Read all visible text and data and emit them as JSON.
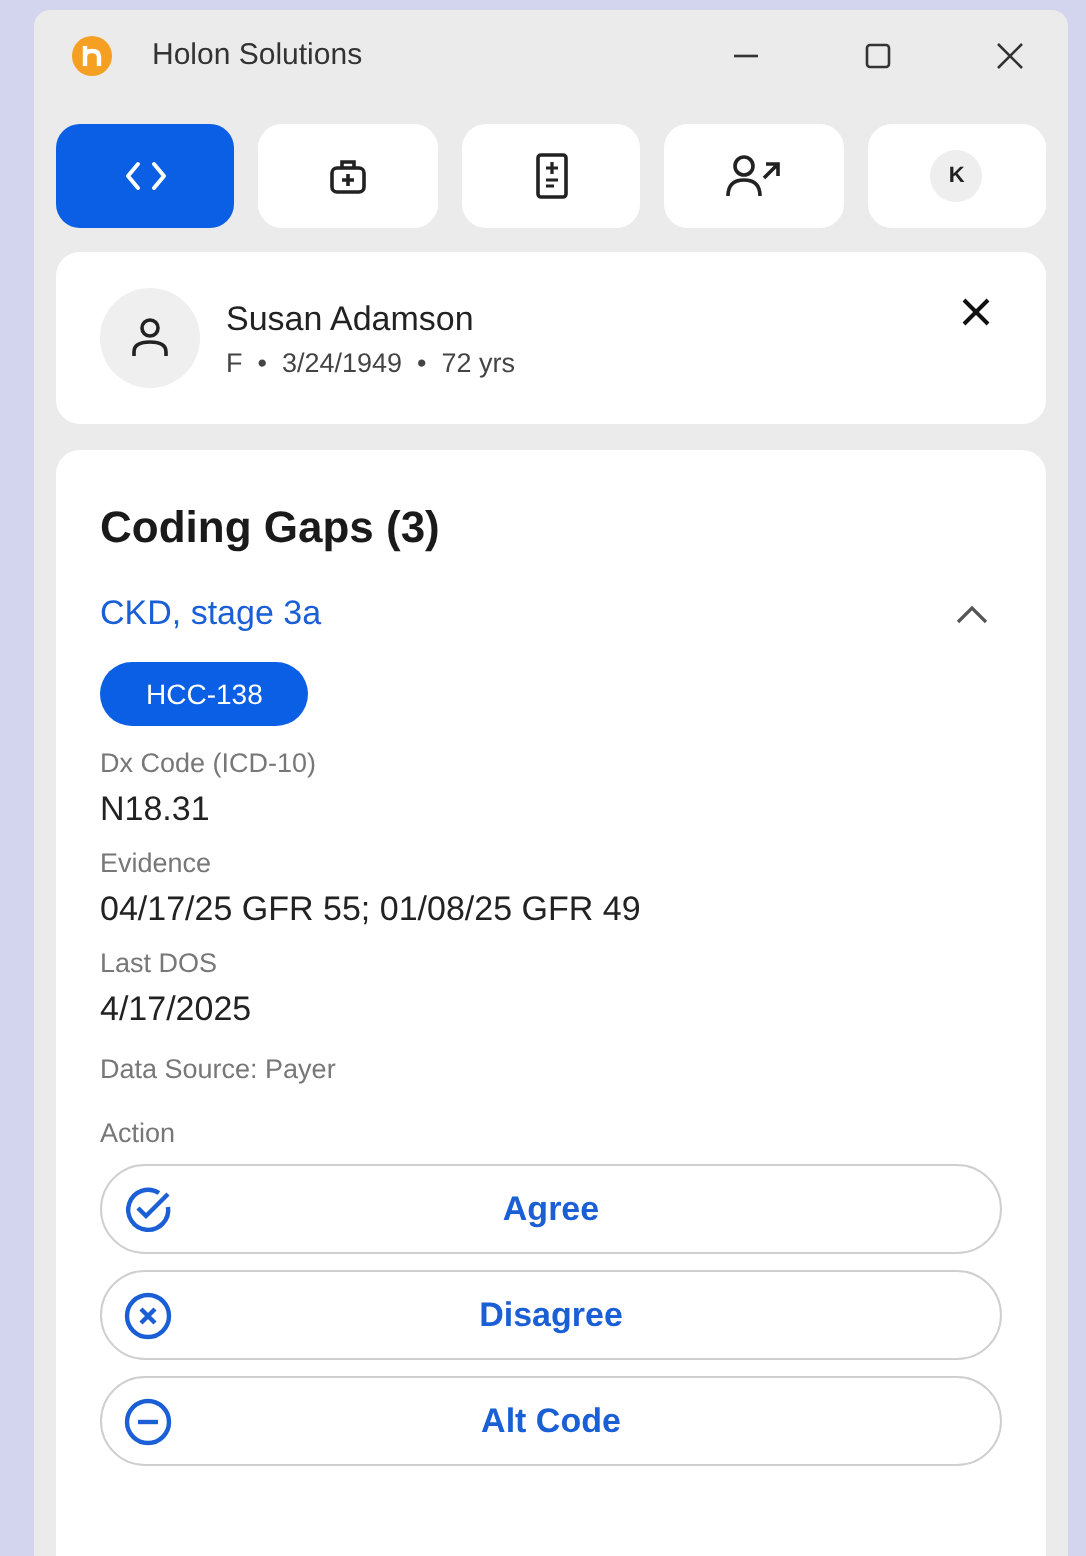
{
  "window": {
    "title": "Holon Solutions"
  },
  "tabs": [
    {
      "kind": "code",
      "selected": true
    },
    {
      "kind": "kit",
      "selected": false
    },
    {
      "kind": "document",
      "selected": false
    },
    {
      "kind": "user-arrow",
      "selected": false
    },
    {
      "kind": "avatar",
      "label": "K",
      "selected": false
    }
  ],
  "patient": {
    "name": "Susan Adamson",
    "details": "F  •  3/24/1949  •  72 yrs"
  },
  "section": {
    "title": "Coding Gaps (3)"
  },
  "gaps": [
    {
      "title": "CKD, stage 3a",
      "expanded": true,
      "tag": "HCC-138",
      "fields": [
        {
          "label": "Dx Code (ICD-10)",
          "value": "N18.31"
        },
        {
          "label": "Evidence",
          "value": "04/17/25 GFR 55; 01/08/25 GFR 49"
        },
        {
          "label": "Last DOS",
          "value": "4/17/2025"
        }
      ],
      "source": "Data Source: Payer",
      "action_label": "Action",
      "actions": [
        {
          "kind": "agree",
          "label": "Agree"
        },
        {
          "kind": "disagree",
          "label": "Disagree"
        },
        {
          "kind": "alt",
          "label": "Alt Code"
        }
      ]
    }
  ]
}
